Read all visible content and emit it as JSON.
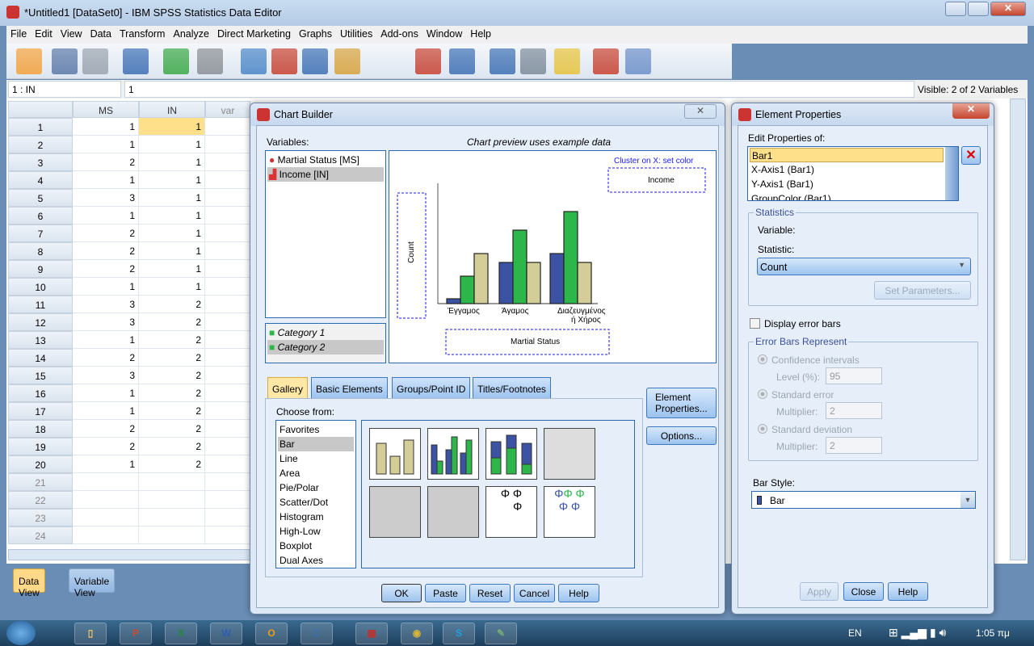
{
  "window": {
    "title": "*Untitled1 [DataSet0] - IBM SPSS Statistics Data Editor"
  },
  "menu": [
    "File",
    "Edit",
    "View",
    "Data",
    "Transform",
    "Analyze",
    "Direct Marketing",
    "Graphs",
    "Utilities",
    "Add-ons",
    "Window",
    "Help"
  ],
  "toolbar_icons": [
    "open-folder-icon",
    "save-icon",
    "print-icon",
    "recall-dialog-icon",
    "undo-icon",
    "redo-icon",
    "goto-case-icon",
    "goto-variable-icon",
    "variables-icon",
    "value-labels-icon",
    "find-icon",
    "insert-cases-icon",
    "insert-variable-icon",
    "split-file-icon",
    "weight-cases-icon",
    "select-cases-icon",
    "value-labels-toggle-icon",
    "use-sets-icon",
    "show-all-variables-icon",
    "spell-check-icon"
  ],
  "cellbar": {
    "ref": "1 : IN",
    "value": "1",
    "visible": "Visible: 2 of 2 Variables"
  },
  "grid": {
    "columns": [
      "MS",
      "IN",
      "var"
    ],
    "rows": [
      [
        "1",
        "1"
      ],
      [
        "1",
        "1"
      ],
      [
        "2",
        "1"
      ],
      [
        "1",
        "1"
      ],
      [
        "3",
        "1"
      ],
      [
        "1",
        "1"
      ],
      [
        "2",
        "1"
      ],
      [
        "2",
        "1"
      ],
      [
        "2",
        "1"
      ],
      [
        "1",
        "1"
      ],
      [
        "3",
        "2"
      ],
      [
        "3",
        "2"
      ],
      [
        "1",
        "2"
      ],
      [
        "2",
        "2"
      ],
      [
        "3",
        "2"
      ],
      [
        "1",
        "2"
      ],
      [
        "1",
        "2"
      ],
      [
        "2",
        "2"
      ],
      [
        "2",
        "2"
      ],
      [
        "1",
        "2"
      ],
      [
        "",
        ""
      ],
      [
        "",
        ""
      ],
      [
        "",
        ""
      ],
      [
        "",
        ""
      ]
    ],
    "row_labels": [
      "1",
      "2",
      "3",
      "4",
      "5",
      "6",
      "7",
      "8",
      "9",
      "10",
      "11",
      "12",
      "13",
      "14",
      "15",
      "16",
      "17",
      "18",
      "19",
      "20",
      "21",
      "22",
      "23",
      "24"
    ]
  },
  "view_tabs": {
    "data": "Data View",
    "variable": "Variable View"
  },
  "chart_builder": {
    "title": "Chart Builder",
    "variables_label": "Variables:",
    "variables": [
      "Martial Status [MS]",
      "Income [IN]"
    ],
    "categories": [
      "Category 1",
      "Category 2"
    ],
    "preview_note": "Chart preview uses example data",
    "cluster_label": "Cluster on X: set color",
    "cluster_var": "Income",
    "y_axis": "Count",
    "x_axis": "Martial Status",
    "x_ticks": [
      "Έγγαμος",
      "Άγαμος",
      "Διαζευγμένος",
      "ή Χήρος"
    ],
    "tabs": [
      "Gallery",
      "Basic Elements",
      "Groups/Point ID",
      "Titles/Footnotes"
    ],
    "choose_from": "Choose from:",
    "gallery_types": [
      "Favorites",
      "Bar",
      "Line",
      "Area",
      "Pie/Polar",
      "Scatter/Dot",
      "Histogram",
      "High-Low",
      "Boxplot",
      "Dual Axes"
    ],
    "side_buttons": {
      "element": "Element Properties...",
      "options": "Options..."
    },
    "buttons": {
      "ok": "OK",
      "paste": "Paste",
      "reset": "Reset",
      "cancel": "Cancel",
      "help": "Help"
    }
  },
  "element_properties": {
    "title": "Element Properties",
    "edit_label": "Edit Properties of:",
    "elements": [
      "Bar1",
      "X-Axis1 (Bar1)",
      "Y-Axis1 (Bar1)",
      "GroupColor (Bar1)"
    ],
    "statistics_group": "Statistics",
    "variable_label": "Variable:",
    "statistic_label": "Statistic:",
    "statistic_value": "Count",
    "set_parameters": "Set Parameters...",
    "display_error_bars": "Display error bars",
    "error_group": "Error Bars Represent",
    "ci": "Confidence intervals",
    "level_label": "Level (%):",
    "level_value": "95",
    "se": "Standard error",
    "se_mult_label": "Multiplier:",
    "se_mult": "2",
    "sd": "Standard deviation",
    "sd_mult_label": "Multiplier:",
    "sd_mult": "2",
    "bar_style_label": "Bar Style:",
    "bar_style_value": "Bar",
    "buttons": {
      "apply": "Apply",
      "close": "Close",
      "help": "Help"
    }
  },
  "taskbar": {
    "lang": "EN",
    "time": "1:05 πμ",
    "apps": [
      "explorer",
      "powerpoint",
      "excel",
      "word",
      "outlook",
      "spss",
      "app",
      "chrome",
      "skype",
      "paint"
    ]
  },
  "colors": {
    "blue_bar": "#3c53a4",
    "green_bar": "#2db64a",
    "tan_bar": "#d3cd97",
    "highlight": "#ffe08a",
    "accent": "#2c68b3"
  }
}
